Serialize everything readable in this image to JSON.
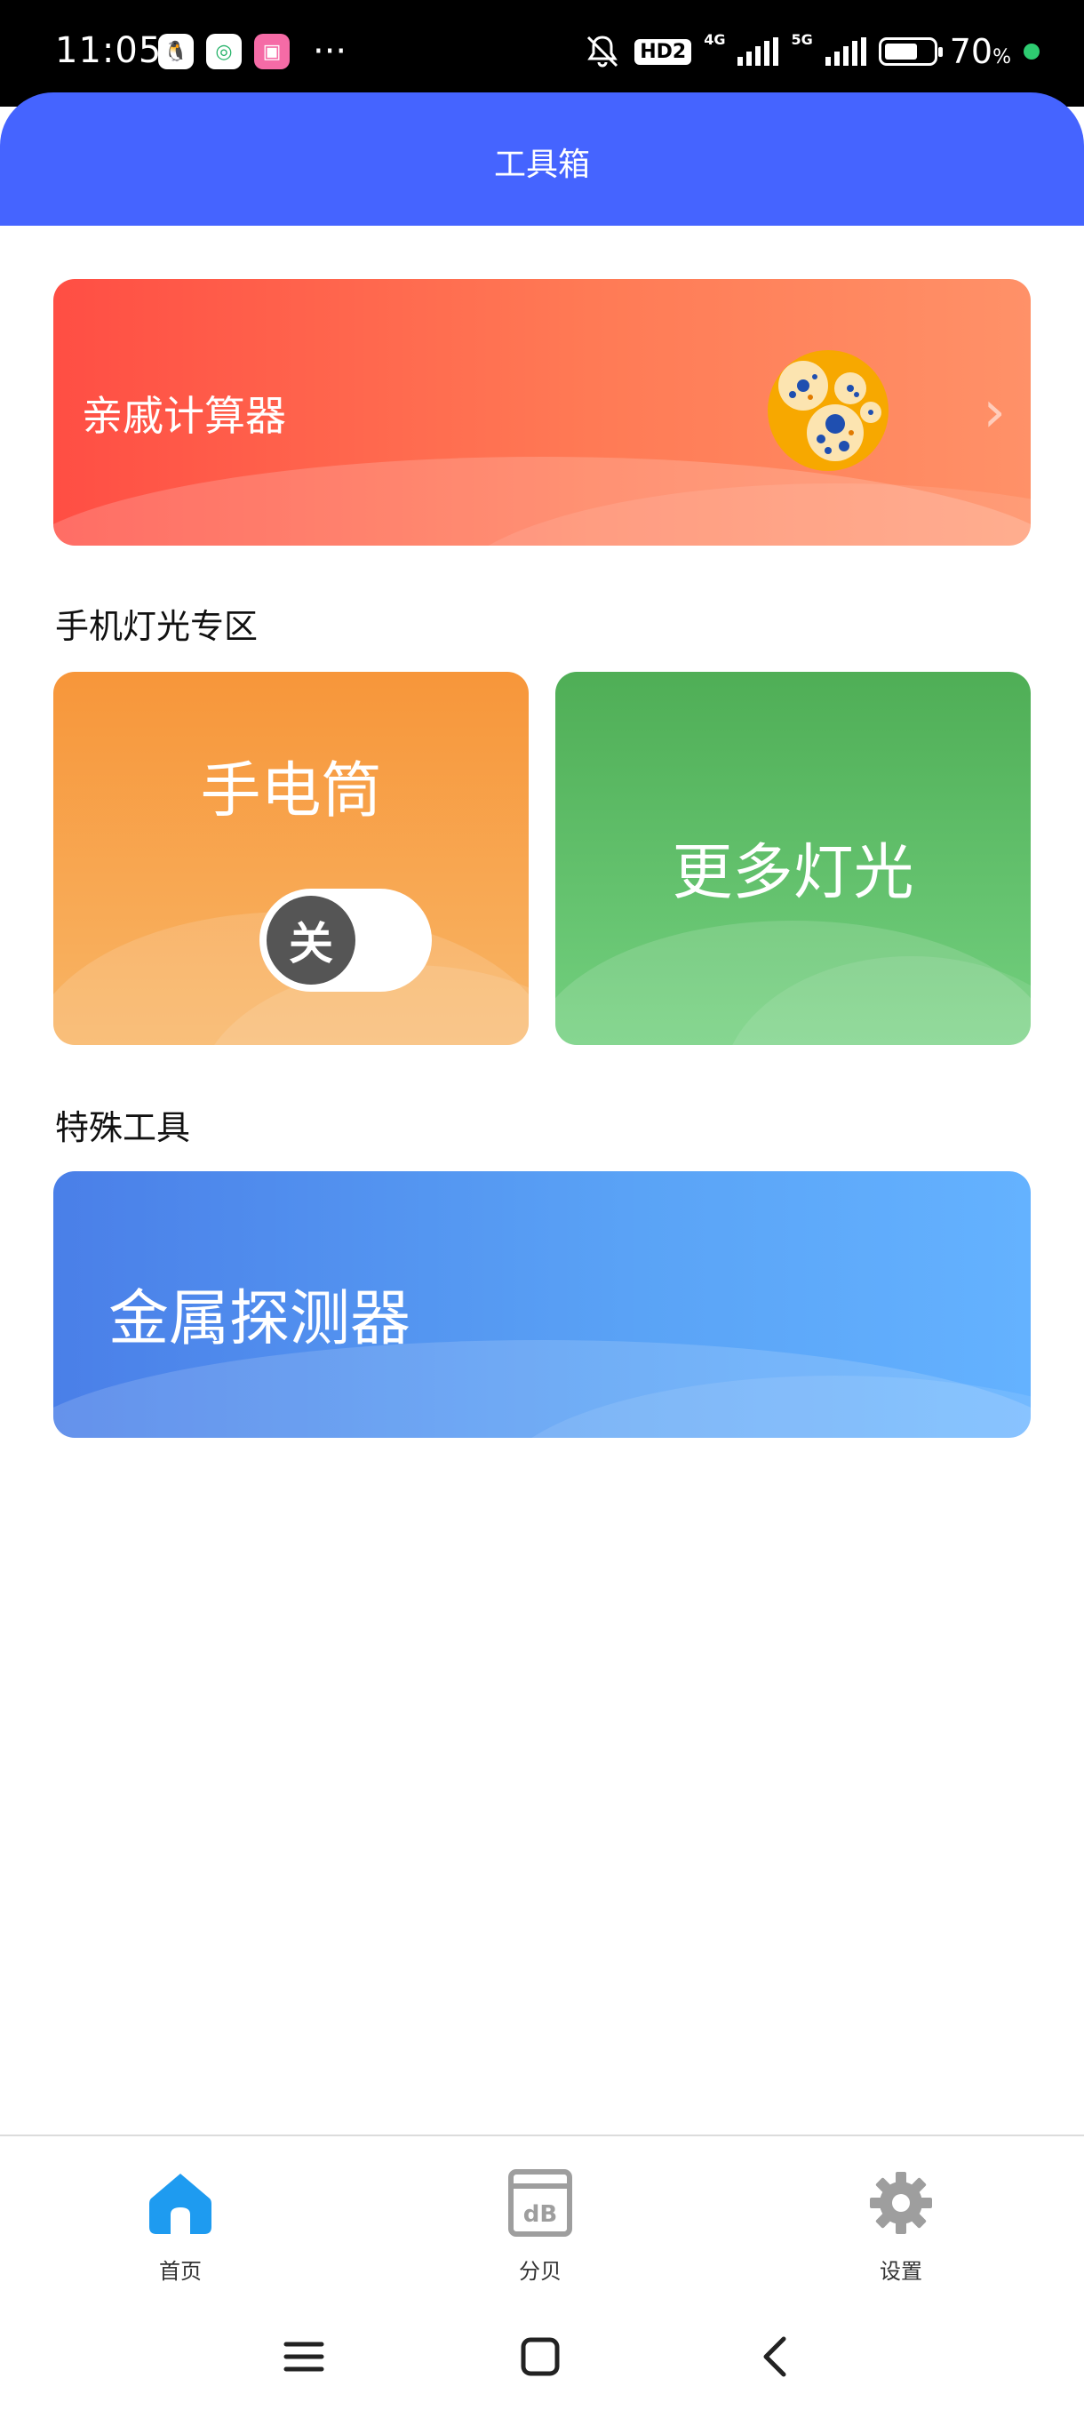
{
  "status_bar": {
    "time": "11:05",
    "app_icons": [
      "qq-icon",
      "green-app-icon",
      "bilibili-icon"
    ],
    "more": "···",
    "hd": "HD2",
    "net1": "4G",
    "net2": "5G",
    "battery_percent": "70",
    "battery_unit": "%",
    "battery_level": 0.7
  },
  "app_bar": {
    "title": "工具箱"
  },
  "relative_calculator": {
    "label": "亲戚计算器"
  },
  "light_section": {
    "title": "手机灯光专区"
  },
  "flashlight": {
    "title": "手电筒",
    "toggle_state": "关"
  },
  "more_light": {
    "title": "更多灯光"
  },
  "special_section": {
    "title": "特殊工具"
  },
  "metal_detector": {
    "title": "金属探测器"
  },
  "tabs": [
    {
      "label": "首页",
      "icon": "home-icon",
      "active": true,
      "color": "#1e9bf0"
    },
    {
      "label": "分贝",
      "icon": "db-meter-icon",
      "active": false,
      "color": "#9e9e9e"
    },
    {
      "label": "设置",
      "icon": "gear-icon",
      "active": false,
      "color": "#9e9e9e"
    }
  ],
  "colors": {
    "app_bar": "#4564ff",
    "relative_card": "#ff5a47",
    "flashlight_card": "#f7963a",
    "more_light_card": "#4fae56",
    "metal_card": "#4a7fe8"
  }
}
